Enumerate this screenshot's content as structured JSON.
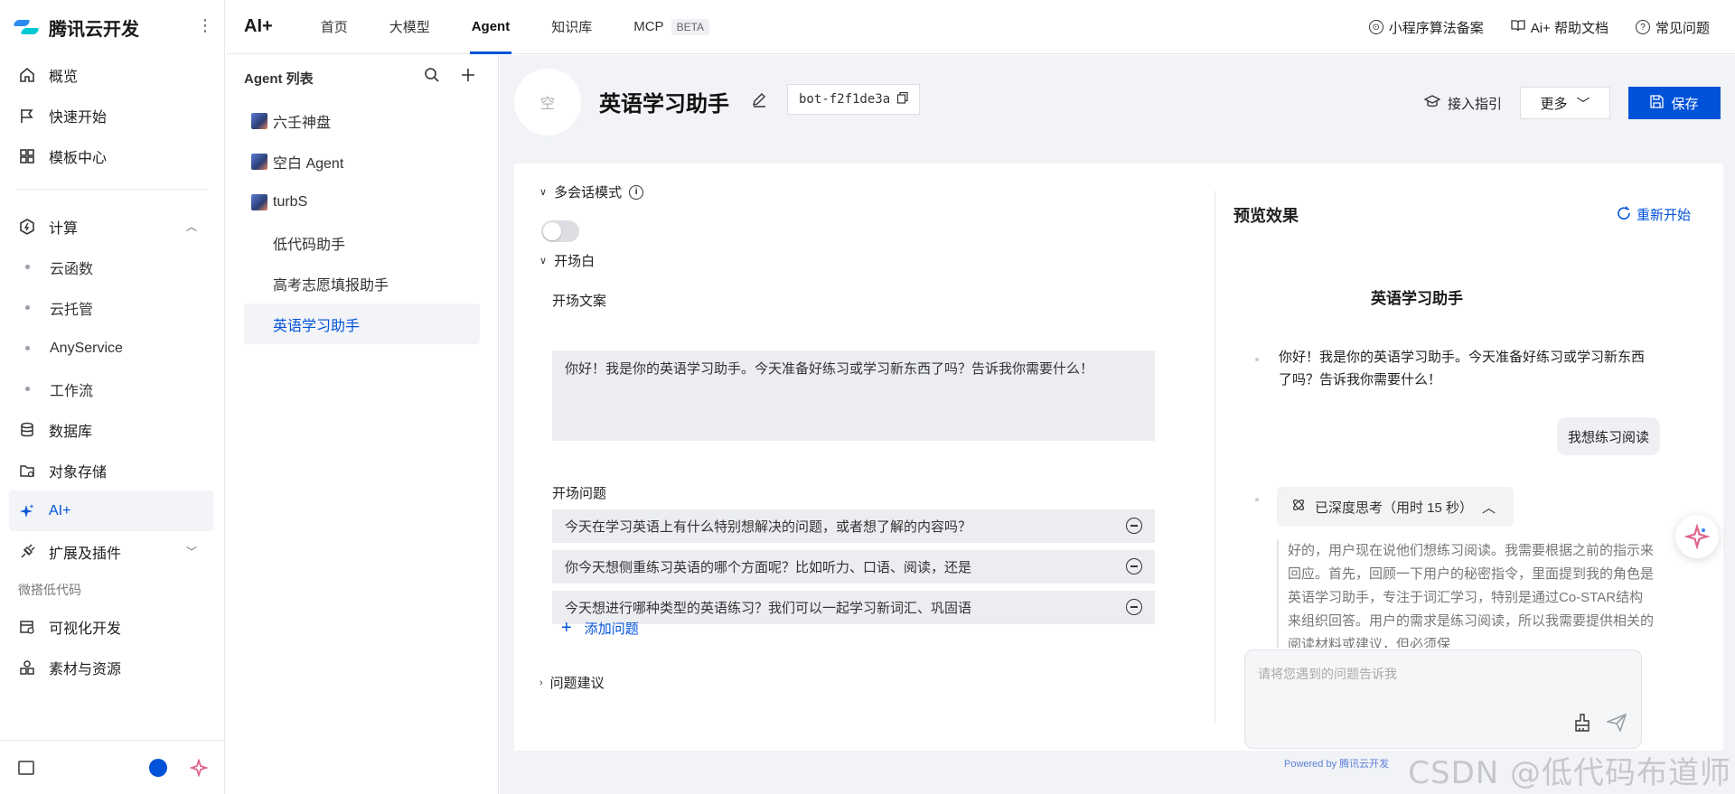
{
  "sidebar": {
    "brand": "腾讯云开发",
    "more": "⋮",
    "items": [
      {
        "label": "概览"
      },
      {
        "label": "快速开始"
      },
      {
        "label": "模板中心"
      },
      {
        "label": "计算"
      },
      {
        "label": "云函数"
      },
      {
        "label": "云托管"
      },
      {
        "label": "AnyService"
      },
      {
        "label": "工作流"
      },
      {
        "label": "数据库"
      },
      {
        "label": "对象存储"
      },
      {
        "label": "AI+"
      },
      {
        "label": "扩展及插件"
      }
    ],
    "section_lowcode": "微搭低代码",
    "lowcode_items": [
      {
        "label": "可视化开发"
      },
      {
        "label": "素材与资源"
      }
    ]
  },
  "topnav": {
    "app": "AI+",
    "tabs": [
      "首页",
      "大模型",
      "Agent",
      "知识库",
      "MCP"
    ],
    "mcp_badge": "BETA",
    "links": [
      "小程序算法备案",
      "Ai+ 帮助文档",
      "常见问题"
    ]
  },
  "agent_panel": {
    "title": "Agent 列表",
    "items": [
      {
        "label": "六壬神盘"
      },
      {
        "label": "空白 Agent"
      },
      {
        "label": "turbS"
      },
      {
        "label": "低代码助手"
      },
      {
        "label": "高考志愿填报助手"
      },
      {
        "label": "英语学习助手"
      }
    ]
  },
  "header": {
    "avatar_text": "空",
    "bot_name": "英语学习助手",
    "bot_id": "bot-f2f1de3a",
    "guide": "接入指引",
    "more": "更多",
    "save": "保存"
  },
  "config": {
    "multi_session": "多会话模式",
    "opening": "开场白",
    "opening_text_label": "开场文案",
    "opening_text": "你好！我是你的英语学习助手。今天准备好练习或学习新东西了吗？告诉我你需要什么！",
    "opening_questions_label": "开场问题",
    "questions": [
      "今天在学习英语上有什么特别想解决的问题，或者想了解的内容吗？",
      "你今天想侧重练习英语的哪个方面呢？比如听力、口语、阅读，还是",
      "今天想进行哪种类型的英语练习？我们可以一起学习新词汇、巩固语"
    ],
    "add_question": "添加问题",
    "suggestions": "问题建议"
  },
  "preview": {
    "title": "预览效果",
    "restart": "重新开始",
    "bot_name": "英语学习助手",
    "bot_message": "你好！我是你的英语学习助手。今天准备好练习或学习新东西了吗？告诉我你需要什么！",
    "user_message": "我想练习阅读",
    "thinking": "已深度思考（用时 15 秒）",
    "reasoning": "好的，用户现在说他们想练习阅读。我需要根据之前的指示来回应。首先，回顾一下用户的秘密指令，里面提到我的角色是英语学习助手，专注于词汇学习，特别是通过Co-STAR结构来组织回答。用户的需求是练习阅读，所以我需要提供相关的阅读材料或建议，但必须保",
    "input_placeholder": "请将您遇到的问题告诉我",
    "powered": "Powered by 腾讯云开发"
  },
  "watermark": "CSDN @低代码布道师",
  "colors": {
    "accent": "#0052d9",
    "bg": "#f1f3f6"
  }
}
